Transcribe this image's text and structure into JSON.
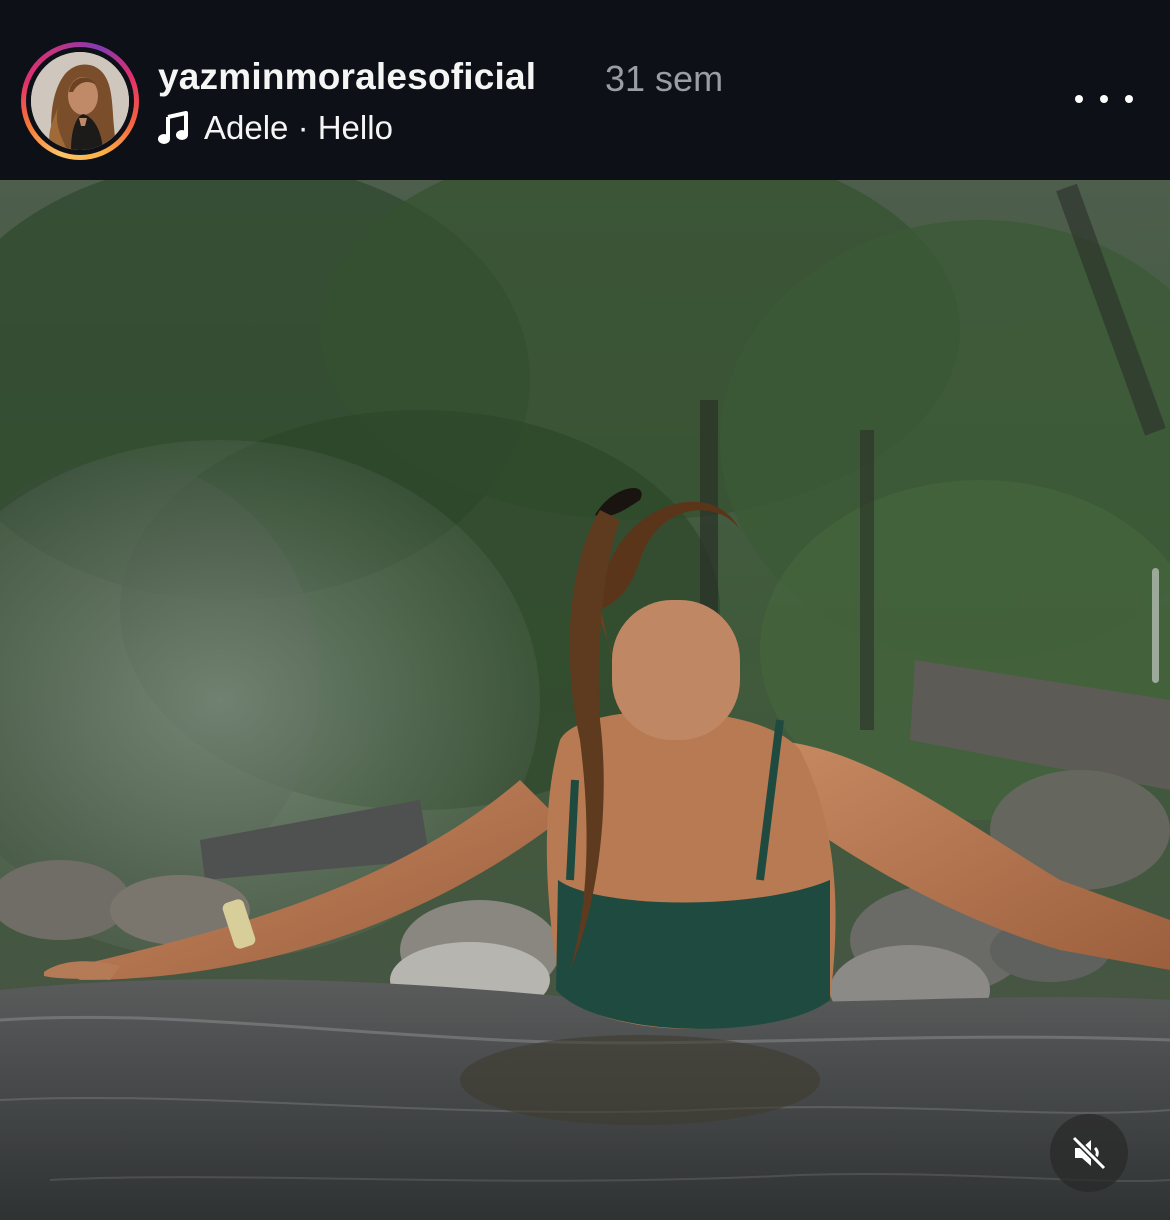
{
  "post_header": {
    "username": "yazminmoralesoficial",
    "time_ago": "31 sem",
    "music": {
      "icon": "music-note-icon",
      "label": "Adele · Hello"
    },
    "more_icon": "more-options-icon"
  },
  "media": {
    "type": "photo",
    "mute_icon": "speaker-muted-icon"
  },
  "colors": {
    "background": "#0d1016",
    "username": "#f5f5f5",
    "time": "#9a9da4"
  }
}
